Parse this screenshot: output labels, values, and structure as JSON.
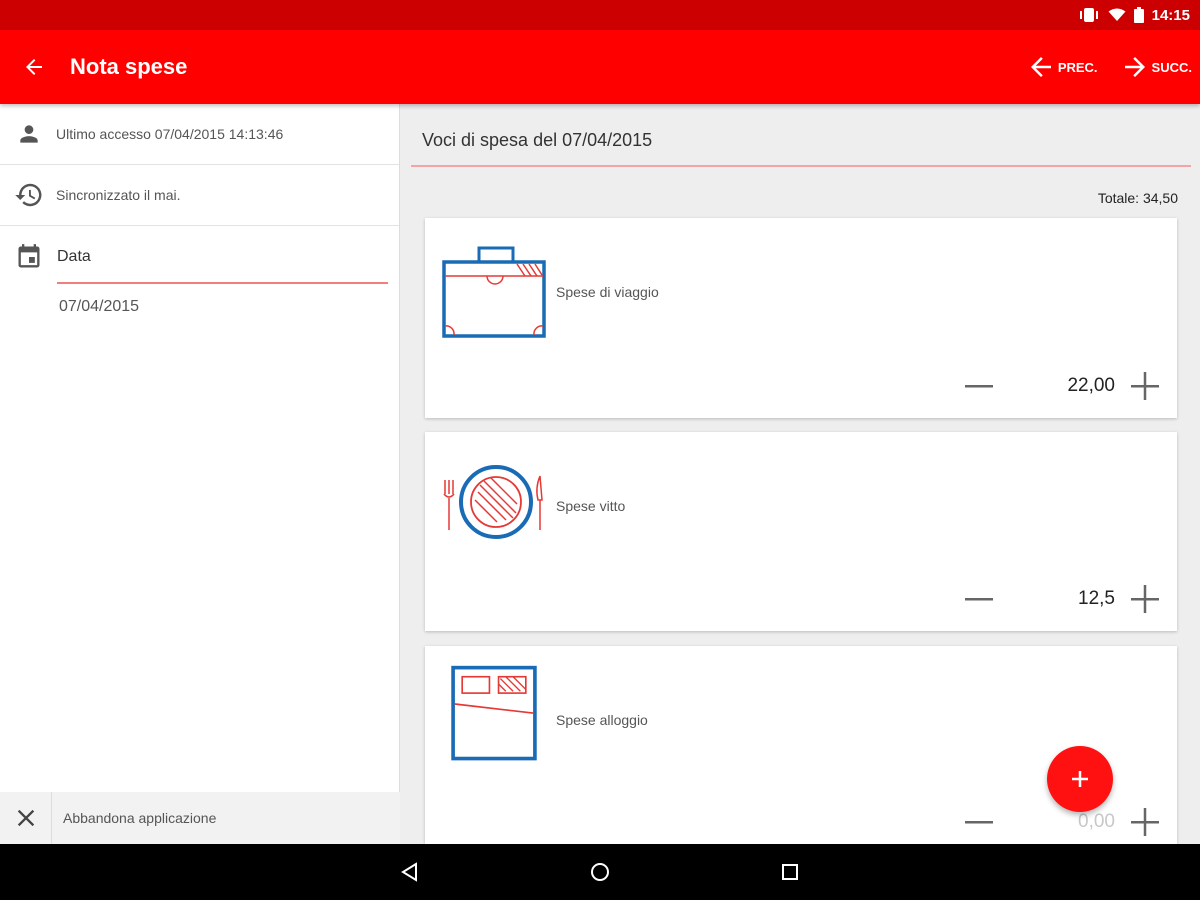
{
  "status_bar": {
    "time": "14:15"
  },
  "app_bar": {
    "title": "Nota spese",
    "prev_label": "PREC.",
    "next_label": "SUCC."
  },
  "sidebar": {
    "last_access": "Ultimo accesso 07/04/2015 14:13:46",
    "sync_status": "Sincronizzato il mai.",
    "date_label": "Data",
    "date_value": "07/04/2015",
    "exit_label": "Abbandona applicazione"
  },
  "main": {
    "section_title": "Voci di spesa del 07/04/2015",
    "total": "Totale: 34,50",
    "items": [
      {
        "label": "Spese di viaggio",
        "amount": "22,00",
        "icon": "suitcase-icon"
      },
      {
        "label": "Spese vitto",
        "amount": "12,5",
        "icon": "plate-cutlery-icon"
      },
      {
        "label": "Spese alloggio",
        "amount": "0,00",
        "icon": "bed-icon"
      }
    ]
  },
  "colors": {
    "primary": "#ff0000",
    "status_bar": "#cc0000",
    "icon_blue": "#1a6bb5",
    "icon_red": "#e53935"
  }
}
